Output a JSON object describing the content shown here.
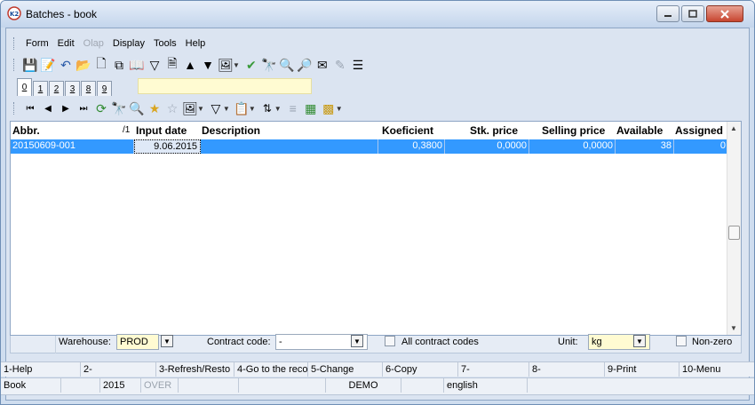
{
  "window": {
    "title": "Batches - book"
  },
  "menu": [
    "Form",
    "Edit",
    "Olap",
    "Display",
    "Tools",
    "Help"
  ],
  "menu_disabled": [
    "Olap"
  ],
  "tabs": [
    "0",
    "1",
    "2",
    "3",
    "8",
    "9"
  ],
  "table": {
    "columns": [
      "Abbr.",
      "Input date",
      "Description",
      "Koeficient",
      "Stk. price",
      "Selling price",
      "Available",
      "Assigned"
    ],
    "sort_indicator": "/1",
    "rows": [
      {
        "abbr": "20150609-001",
        "input_date": "9.06.2015",
        "description": "",
        "koeficient": "0,3800",
        "stk_price": "0,0000",
        "selling_price": "0,0000",
        "available": "38",
        "assigned": "0"
      }
    ]
  },
  "filters": {
    "warehouse_label": "Warehouse:",
    "warehouse_value": "PROD",
    "contract_code_label": "Contract code:",
    "contract_code_value": "-",
    "all_contract_codes_label": "All contract codes",
    "unit_label": "Unit:",
    "unit_value": "kg",
    "non_zero_label": "Non-zero"
  },
  "fkeys": [
    "1-Help",
    "2-",
    "3-Refresh/Resto",
    "4-Go to the reco",
    "5-Change",
    "6-Copy",
    "7-",
    "8-",
    "9-Print",
    "10-Menu"
  ],
  "status": {
    "book": "Book",
    "year": "2015",
    "over": "OVER",
    "demo": "DEMO",
    "language": "english"
  },
  "colors": {
    "selection": "#3399ff",
    "input_bg": "#fffbd2",
    "window_bg": "#dbe4f1"
  }
}
